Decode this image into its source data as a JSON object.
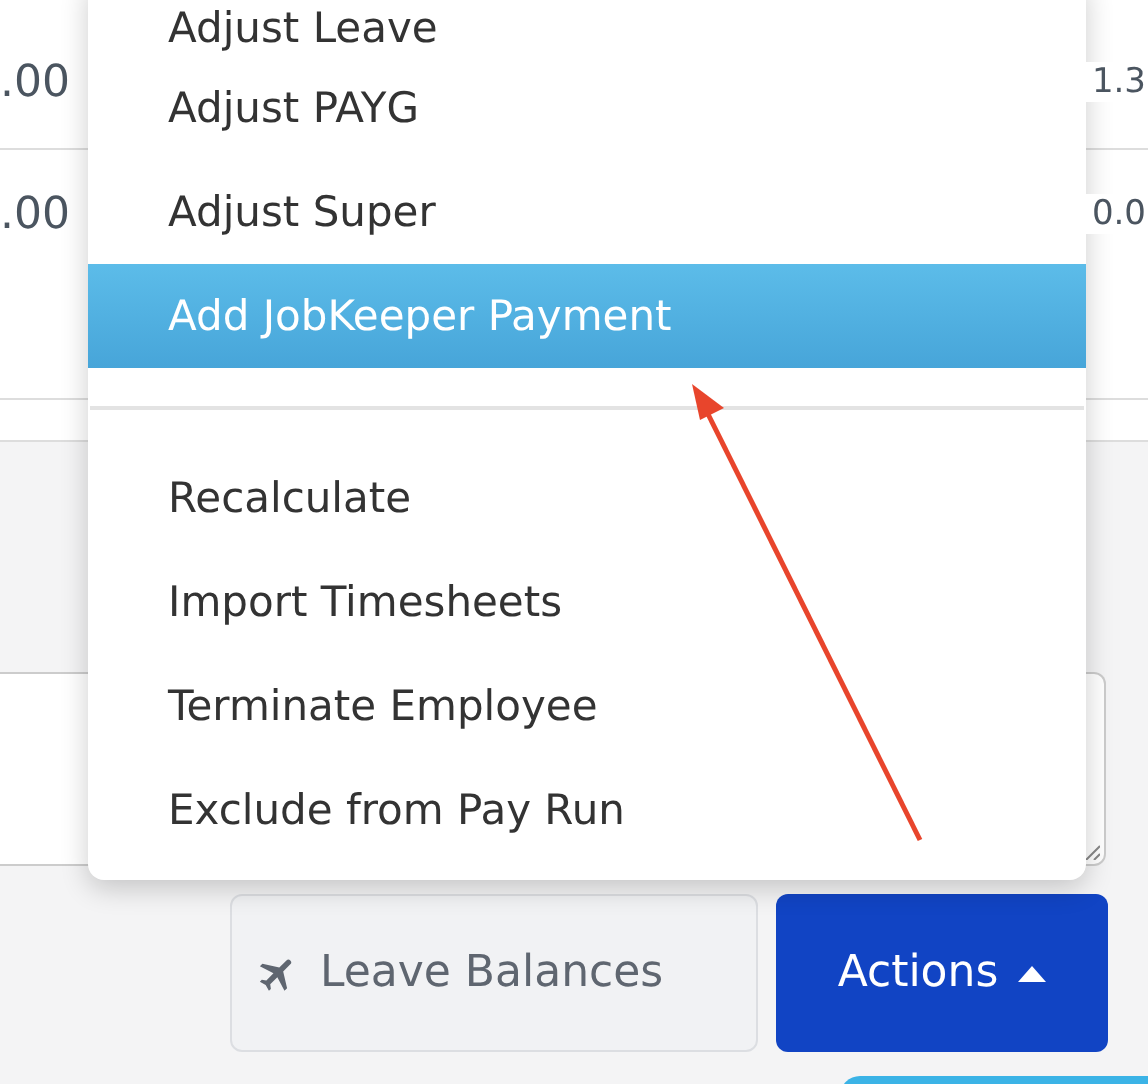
{
  "table": {
    "rows": [
      {
        "cells": [
          ".00",
          "1.3"
        ]
      },
      {
        "cells": [
          ".00",
          "0.0"
        ]
      }
    ]
  },
  "menu": {
    "items": [
      {
        "kind": "item",
        "label": "Adjust Leave",
        "selected": false
      },
      {
        "kind": "item",
        "label": "Adjust PAYG",
        "selected": false
      },
      {
        "kind": "item",
        "label": "Adjust Super",
        "selected": false
      },
      {
        "kind": "item",
        "label": "Add JobKeeper Payment",
        "selected": true
      },
      {
        "kind": "divider"
      },
      {
        "kind": "item",
        "label": "Recalculate",
        "selected": false
      },
      {
        "kind": "item",
        "label": "Import Timesheets",
        "selected": false
      },
      {
        "kind": "item",
        "label": "Terminate Employee",
        "selected": false
      },
      {
        "kind": "item",
        "label": "Exclude from Pay Run",
        "selected": false
      }
    ]
  },
  "buttons": [
    {
      "kind": "leave",
      "label": "Leave Balances"
    },
    {
      "kind": "actions",
      "label": "Actions"
    }
  ]
}
